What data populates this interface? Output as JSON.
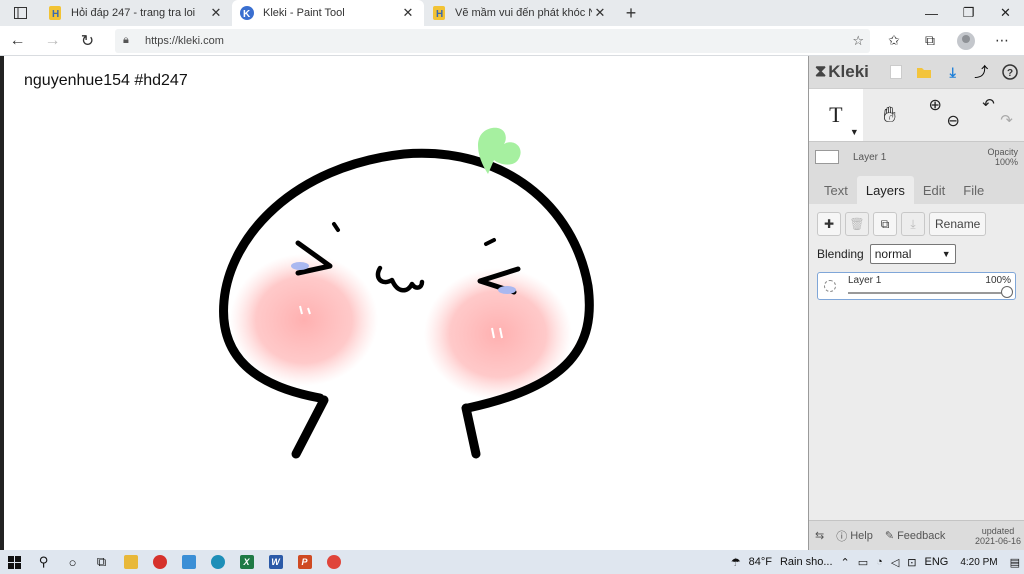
{
  "browser": {
    "tabs": [
      {
        "title": "Hỏi đáp 247 - trang tra loi",
        "favicon": "hd247-icon",
        "active": false
      },
      {
        "title": "Kleki - Paint Tool",
        "favicon": "kleki-icon",
        "active": true
      },
      {
        "title": "Vẽ mầm vui đến phát khóc NL : ",
        "favicon": "hd247-icon",
        "active": false
      }
    ],
    "url": "https://kleki.com",
    "window_controls": {
      "minimize": "—",
      "maximize": "❐",
      "close": "✕"
    }
  },
  "canvas": {
    "caption": "nguyenhue154  #hd247"
  },
  "kleki": {
    "logo": "Kleki",
    "current_tool": "T",
    "layer_name": "Layer 1",
    "opacity_label": "Opacity",
    "opacity_value": "100%",
    "tabs": [
      "Text",
      "Layers",
      "Edit",
      "File"
    ],
    "active_tab": "Layers",
    "rename_label": "Rename",
    "blending_label": "Blending",
    "blending_value": "normal",
    "layers": [
      {
        "name": "Layer 1",
        "opacity": "100%"
      }
    ],
    "footer": {
      "help": "Help",
      "feedback": "Feedback",
      "updated_label": "updated",
      "updated_date": "2021-06-16"
    }
  },
  "taskbar": {
    "weather_temp": "84°F",
    "weather_text": "Rain sho...",
    "language": "ENG",
    "time": "4:20 PM"
  },
  "colors": {
    "tab_bar": "#e7eaed",
    "panel": "#dcdcdc",
    "taskbar": "#dfe6ef",
    "sprout": "#a6f0a0",
    "blush": "#ffb3b3"
  }
}
